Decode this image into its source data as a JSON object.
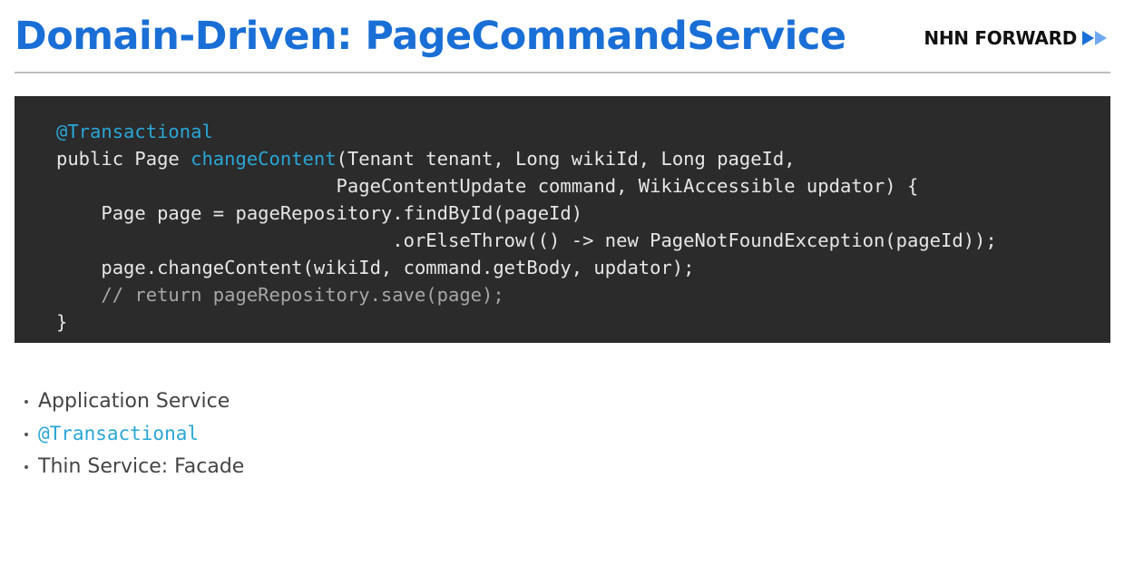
{
  "slide": {
    "title": "Domain-Driven: PageCommandService"
  },
  "brand": {
    "name": "NHN FORWARD",
    "icon": "double-play-arrow-icon",
    "icon_colors": [
      "#1a6fd6",
      "#6fa8f0"
    ]
  },
  "colors": {
    "title": "#1a6fd6",
    "code_background": "#2b2b2b",
    "code_text": "#e6e6e6",
    "code_highlight": "#2aa6d6",
    "code_comment": "#a6a6a6",
    "bullet_text": "#444444"
  },
  "code": {
    "lines": [
      {
        "parts": [
          "",
          "@Transactional",
          ""
        ]
      },
      {
        "parts": [
          "public Page ",
          "changeContent",
          "(Tenant tenant, Long wikiId, Long pageId,"
        ]
      },
      {
        "parts": [
          "                         PageContentUpdate command, WikiAccessible updator) {",
          "",
          ""
        ]
      },
      {
        "parts": [
          "    Page page = pageRepository.findById(pageId)",
          "",
          ""
        ]
      },
      {
        "parts": [
          "                              .orElseThrow(() -> new PageNotFoundException(pageId));",
          "",
          ""
        ]
      },
      {
        "parts": [
          "    page.changeContent(wikiId, command.getBody, updator);",
          "",
          ""
        ]
      },
      {
        "parts": [
          "    // return pageRepository.save(page);",
          "",
          ""
        ]
      },
      {
        "parts": [
          "}",
          "",
          ""
        ]
      }
    ]
  },
  "bullets": [
    {
      "text": "Application Service",
      "style": "text"
    },
    {
      "text": "@Transactional",
      "style": "code"
    },
    {
      "text": "Thin Service: Facade",
      "style": "text"
    }
  ]
}
